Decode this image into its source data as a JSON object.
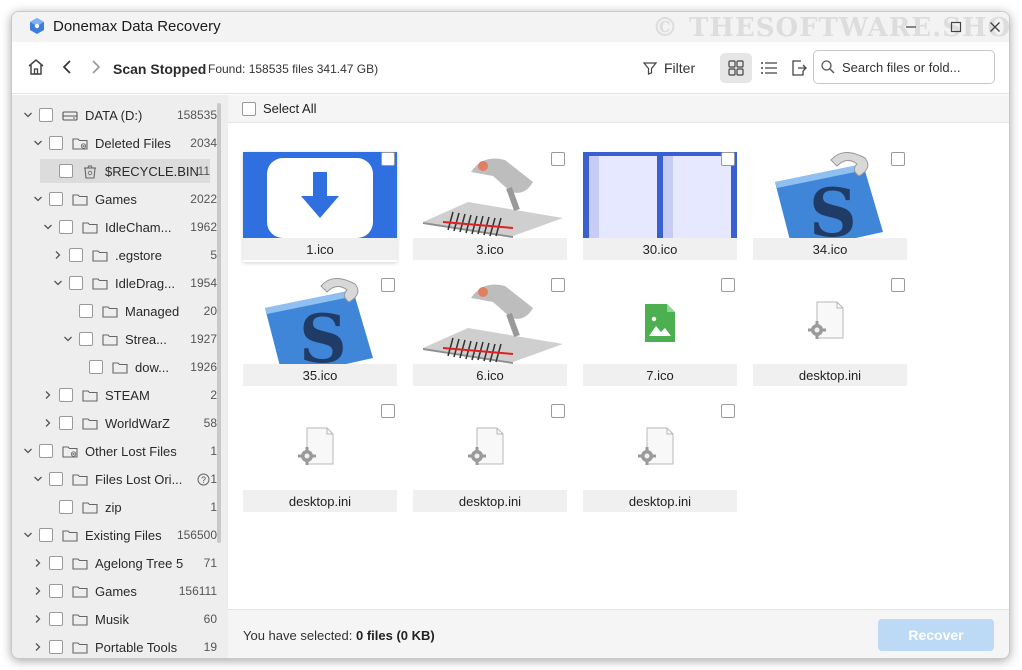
{
  "app": {
    "title": "Donemax Data Recovery",
    "watermark": "© THESOFTWARE.SHOP"
  },
  "toolbar": {
    "status": "Scan Stopped",
    "found": "Found: 158535 files 341.47 GB)",
    "filter_label": "Filter",
    "search_placeholder": "Search files or fold..."
  },
  "sidebar": {
    "items": [
      {
        "label": "DATA (D:)",
        "count": "158535"
      },
      {
        "label": "Deleted Files",
        "count": "2034"
      },
      {
        "label": "$RECYCLE.BIN",
        "count": "11"
      },
      {
        "label": "Games",
        "count": "2022"
      },
      {
        "label": "IdleCham...",
        "count": "1962"
      },
      {
        "label": ".egstore",
        "count": "5"
      },
      {
        "label": "IdleDrag...",
        "count": "1954"
      },
      {
        "label": "Managed",
        "count": "20"
      },
      {
        "label": "Strea...",
        "count": "1927"
      },
      {
        "label": "dow...",
        "count": "1926"
      },
      {
        "label": "STEAM",
        "count": "2"
      },
      {
        "label": "WorldWarZ",
        "count": "58"
      },
      {
        "label": "Other Lost Files",
        "count": "1"
      },
      {
        "label": "Files Lost Ori...",
        "count": "1"
      },
      {
        "label": "zip",
        "count": "1"
      },
      {
        "label": "Existing Files",
        "count": "156500"
      },
      {
        "label": "Agelong Tree 5",
        "count": "71"
      },
      {
        "label": "Games",
        "count": "156111"
      },
      {
        "label": "Musik",
        "count": "60"
      },
      {
        "label": "Portable Tools",
        "count": "19"
      }
    ]
  },
  "main": {
    "select_all": "Select All",
    "files": [
      {
        "name": "1.ico",
        "thumb": "download-arrow-icon"
      },
      {
        "name": "3.ico",
        "thumb": "barcode-scanner-icon"
      },
      {
        "name": "30.ico",
        "thumb": "split-window-icon"
      },
      {
        "name": "34.ico",
        "thumb": "s-letter-icon"
      },
      {
        "name": "35.ico",
        "thumb": "s-letter-icon"
      },
      {
        "name": "6.ico",
        "thumb": "barcode-scanner-icon"
      },
      {
        "name": "7.ico",
        "thumb": "image-file-icon"
      },
      {
        "name": "desktop.ini",
        "thumb": "settings-file-icon"
      },
      {
        "name": "desktop.ini",
        "thumb": "settings-file-icon"
      },
      {
        "name": "desktop.ini",
        "thumb": "settings-file-icon"
      },
      {
        "name": "desktop.ini",
        "thumb": "settings-file-icon"
      }
    ]
  },
  "footer": {
    "selected_prefix": "You have selected: ",
    "selected_value": "0 files (0 KB)",
    "recover_label": "Recover"
  },
  "colors": {
    "accent": "#2f6fd6",
    "recover_disabled": "#bcd9f5",
    "sidebar_bg": "#eeeeee"
  }
}
